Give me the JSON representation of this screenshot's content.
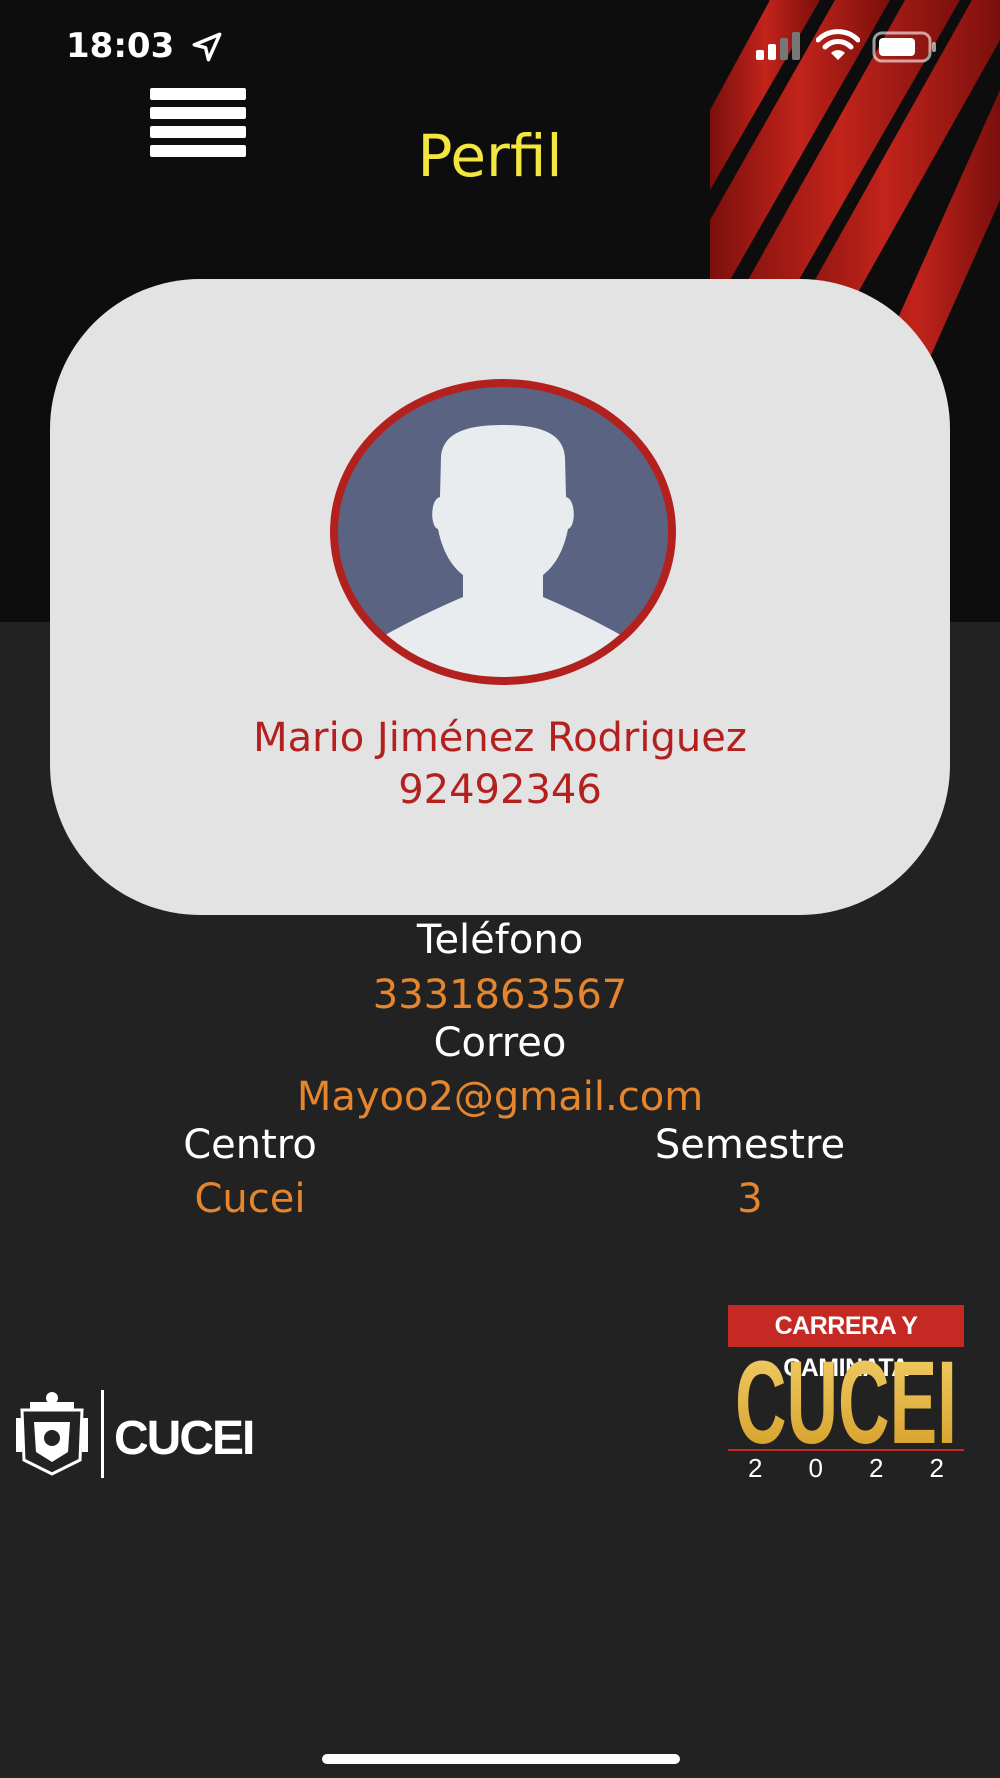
{
  "status_bar": {
    "time": "18:03"
  },
  "header": {
    "title": "Perfil"
  },
  "profile": {
    "name": "Mario Jiménez Rodriguez",
    "id": "92492346"
  },
  "info": {
    "phone_label": "Teléfono",
    "phone_value": "3331863567",
    "email_label": "Correo",
    "email_value": "Mayoo2@gmail.com",
    "center_label": "Centro",
    "center_value": "Cucei",
    "semester_label": "Semestre",
    "semester_value": "3"
  },
  "logos": {
    "university_text": "CUCEI",
    "event_top": "CARRERA Y CAMINATA",
    "event_main": "CUCEI",
    "event_year": "2 0 2 2"
  },
  "colors": {
    "title": "#f3e63e",
    "accent_red": "#b3211e",
    "value_orange": "#e5862f",
    "card_bg": "#e4e3e4",
    "avatar_bg": "#5a6482"
  }
}
